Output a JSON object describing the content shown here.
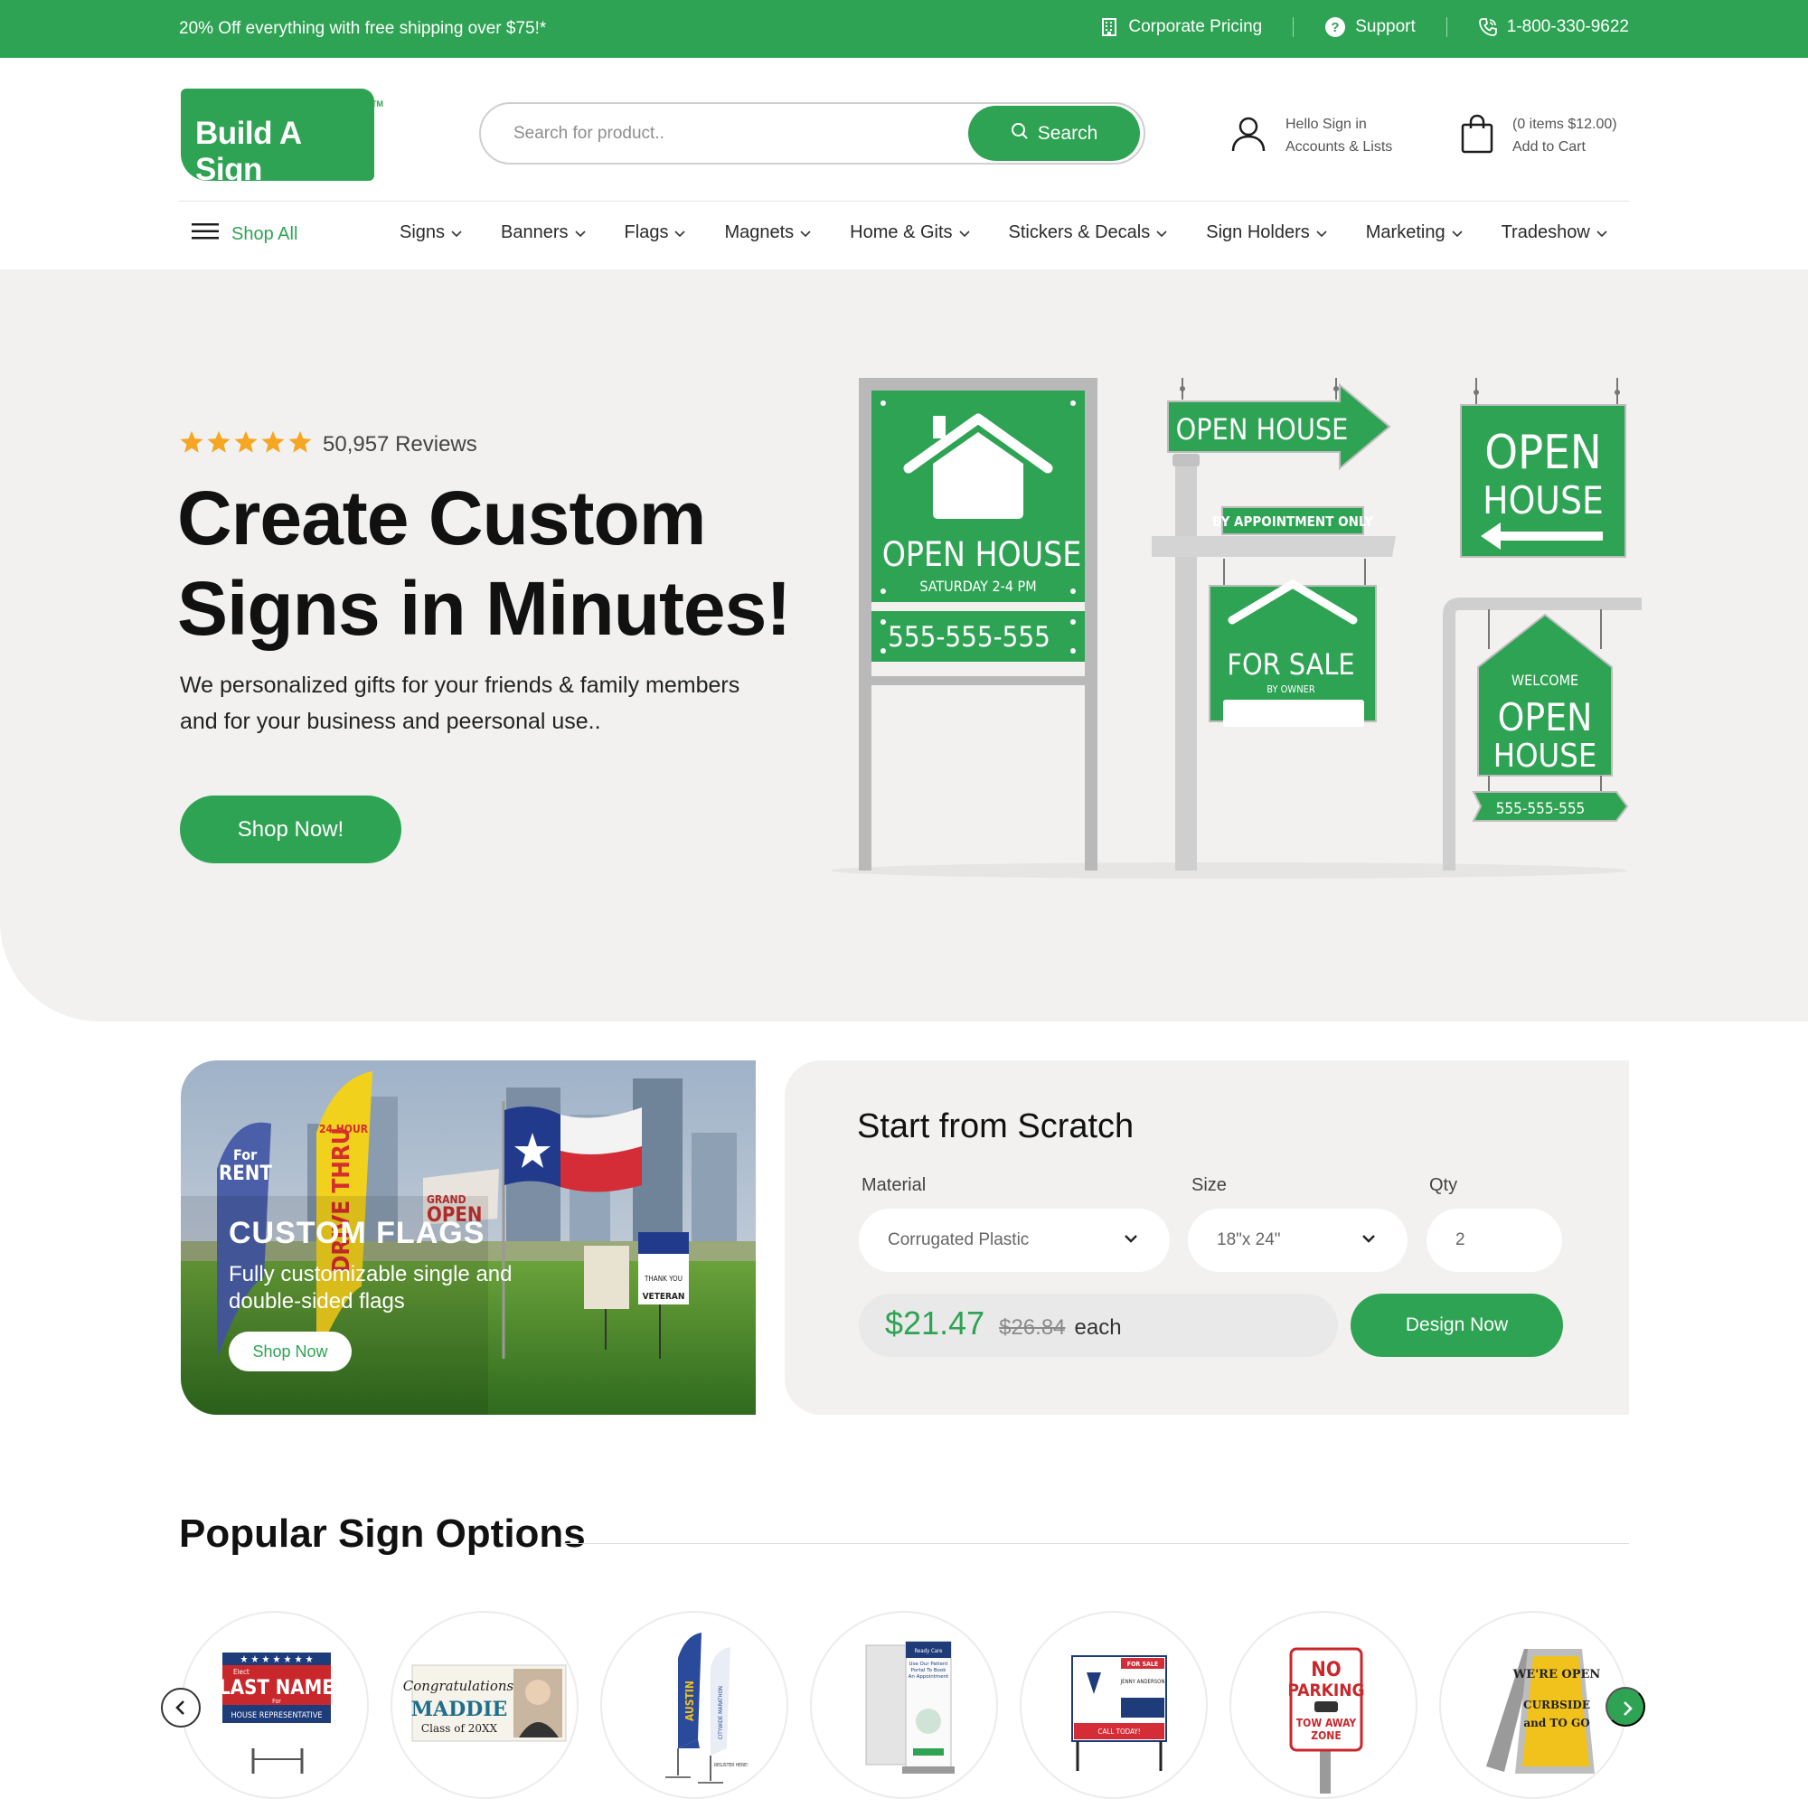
{
  "colors": {
    "brand_green": "#2ea353",
    "hero_bg": "#f2f1f0",
    "star": "#f5a623"
  },
  "topbar": {
    "promo": "20% Off everything with free shipping over $75!*",
    "corporate": "Corporate Pricing",
    "support": "Support",
    "phone": "1-800-330-9622"
  },
  "logo": {
    "text": "Build A Sign",
    "tm": "TM"
  },
  "search": {
    "placeholder": "Search for product..",
    "button": "Search"
  },
  "account": {
    "line1": "Hello Sign in",
    "line2": "Accounts & Lists"
  },
  "cart": {
    "line1": "(0 items $12.00)",
    "line2": "Add to Cart"
  },
  "nav": {
    "shop_all": "Shop All",
    "items": [
      "Signs",
      "Banners",
      "Flags",
      "Magnets",
      "Home & Gits",
      "Stickers & Decals",
      "Sign Holders",
      "Marketing",
      "Tradeshow"
    ]
  },
  "hero": {
    "rating": 5,
    "reviews": "50,957 Reviews",
    "title": "Create Custom Signs in Minutes!",
    "subtitle": "We personalized gifts for your friends & family members and for your business and peersonal use..",
    "cta": "Shop Now!",
    "signs": {
      "s1_title": "OPEN HOUSE",
      "s1_sub": "SATURDAY 2-4 PM",
      "s1_phone": "555-555-555",
      "s2_arrow": "OPEN HOUSE",
      "s2_rider": "BY APPOINTMENT ONLY",
      "s2_title": "FOR SALE",
      "s2_sub": "BY OWNER",
      "s3_l1": "OPEN",
      "s3_l2": "HOUSE",
      "s4_welcome": "WELCOME",
      "s4_l1": "OPEN",
      "s4_l2": "HOUSE",
      "s4_phone": "555-555-555"
    }
  },
  "flags_card": {
    "title": "CUSTOM FLAGS",
    "subtitle": "Fully customizable single and double-sided flags",
    "button": "Shop Now",
    "photo_text": {
      "rent1": "For",
      "rent2": "RENT",
      "thru": "DRIVE THRU",
      "hour": "24 HOUR",
      "open": "OPEN",
      "grand": "GRAND",
      "thank": "THANK YOU",
      "vet": "VETERAN"
    }
  },
  "scratch": {
    "title": "Start from Scratch",
    "material_label": "Material",
    "material_value": "Corrugated Plastic",
    "size_label": "Size",
    "size_value": "18\"x 24\"",
    "qty_label": "Qty",
    "qty_value": "2",
    "price": "$21.47",
    "old_price": "$26.84",
    "each": "each",
    "button": "Design Now"
  },
  "popular": {
    "title": "Popular Sign Options",
    "items": [
      {
        "icon": "campaign-yard-sign",
        "t1": "Elect",
        "t2": "LAST NAME",
        "t3": "For",
        "t4": "HOUSE REPRESENTATIVE"
      },
      {
        "icon": "graduation-banner",
        "t1": "Congratulations!",
        "t2": "MADDIE",
        "t3": "Class of 20XX"
      },
      {
        "icon": "feather-flag",
        "t1": "AUSTIN",
        "t2": "CITYWIDE MARATHON",
        "t3": "REGISTER HERE!"
      },
      {
        "icon": "retractable-banner",
        "t1": "Ready Care",
        "t2": "Use Our Patient Portal To Book An Appointment"
      },
      {
        "icon": "real-estate-sign",
        "t1": "FOR SALE",
        "t2": "JENNY ANDERSON",
        "t3": "CALL TODAY!"
      },
      {
        "icon": "no-parking-sign",
        "t1": "NO",
        "t2": "PARKING",
        "t3": "TOW AWAY",
        "t4": "ZONE"
      },
      {
        "icon": "a-frame-sign",
        "t1": "WE'RE OPEN",
        "t2": "CURBSIDE",
        "t3": "and TO GO"
      }
    ]
  }
}
